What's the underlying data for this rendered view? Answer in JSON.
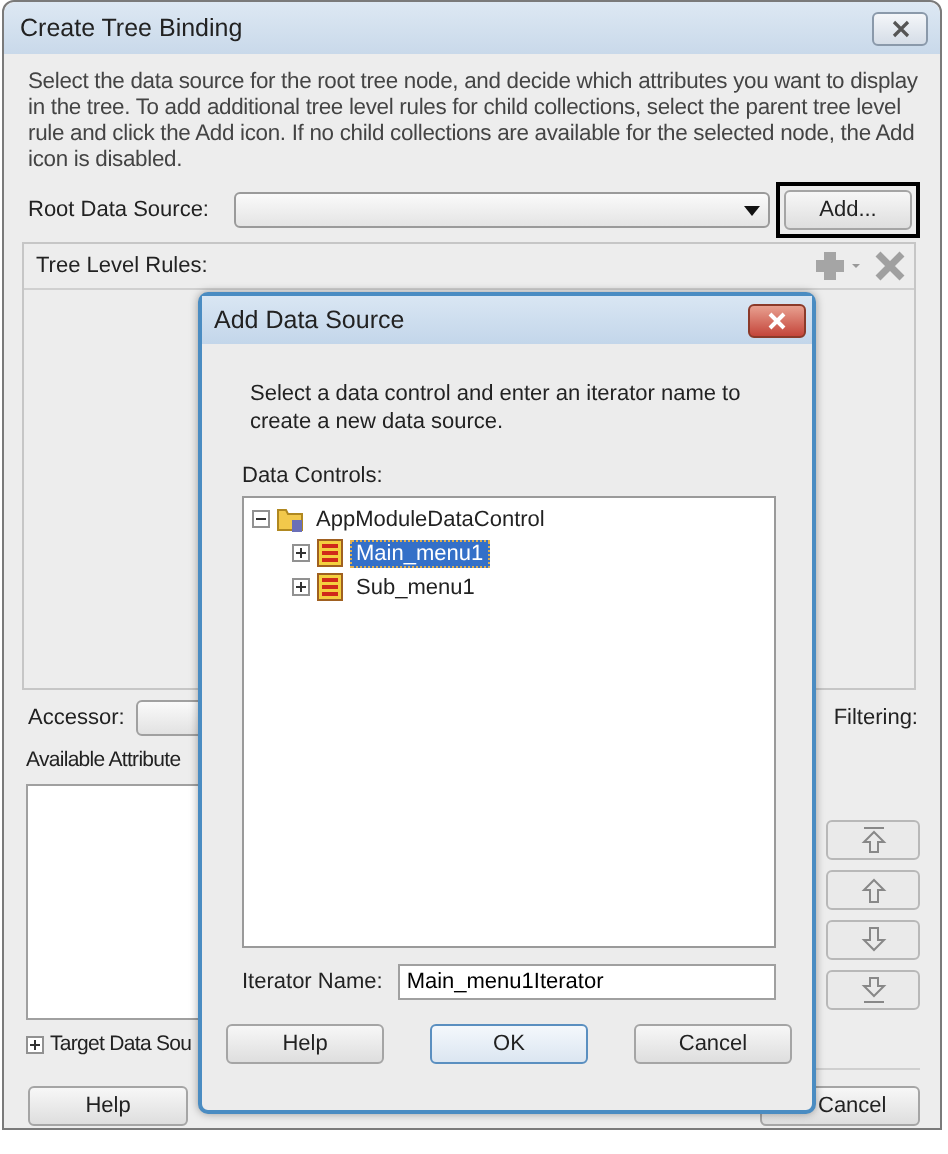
{
  "window": {
    "title": "Create Tree Binding"
  },
  "description": "Select the data source for the root tree node, and decide which attributes you want to display in the tree. To add additional tree level rules for child collections, select the parent tree level rule and click the Add icon. If no child collections are available for the selected node, the Add icon is disabled.",
  "root_data_source": {
    "label": "Root Data Source:"
  },
  "add_button": {
    "label": "Add...",
    "highlighted": true
  },
  "tree_level_rules": {
    "label": "Tree Level Rules:"
  },
  "accessor": {
    "label": "Accessor:"
  },
  "filtering": {
    "label": "Filtering:"
  },
  "available_attributes": {
    "label": "Available Attribute"
  },
  "target_data_source": {
    "label": "Target Data Sou",
    "expanded": false
  },
  "buttons": [
    {
      "label": "Help"
    },
    {
      "label": "Cancel"
    }
  ],
  "dialog": {
    "title": "Add Data Source",
    "instructions": "Select a data control and enter an iterator name to create a new data source.",
    "data_controls_label": "Data Controls:",
    "tree": [
      {
        "label": "AppModuleDataControl",
        "kind": "module",
        "expanded": true,
        "selected": false,
        "children": [
          {
            "label": "Main_menu1",
            "kind": "collection",
            "expanded": false,
            "selected": true
          },
          {
            "label": "Sub_menu1",
            "kind": "collection",
            "expanded": false,
            "selected": false
          }
        ]
      }
    ],
    "iterator_name": {
      "label": "Iterator Name:",
      "value": "Main_menu1Iterator"
    },
    "buttons": [
      {
        "label": "Help",
        "default": false
      },
      {
        "label": "OK",
        "default": true
      },
      {
        "label": "Cancel",
        "default": false
      }
    ]
  }
}
